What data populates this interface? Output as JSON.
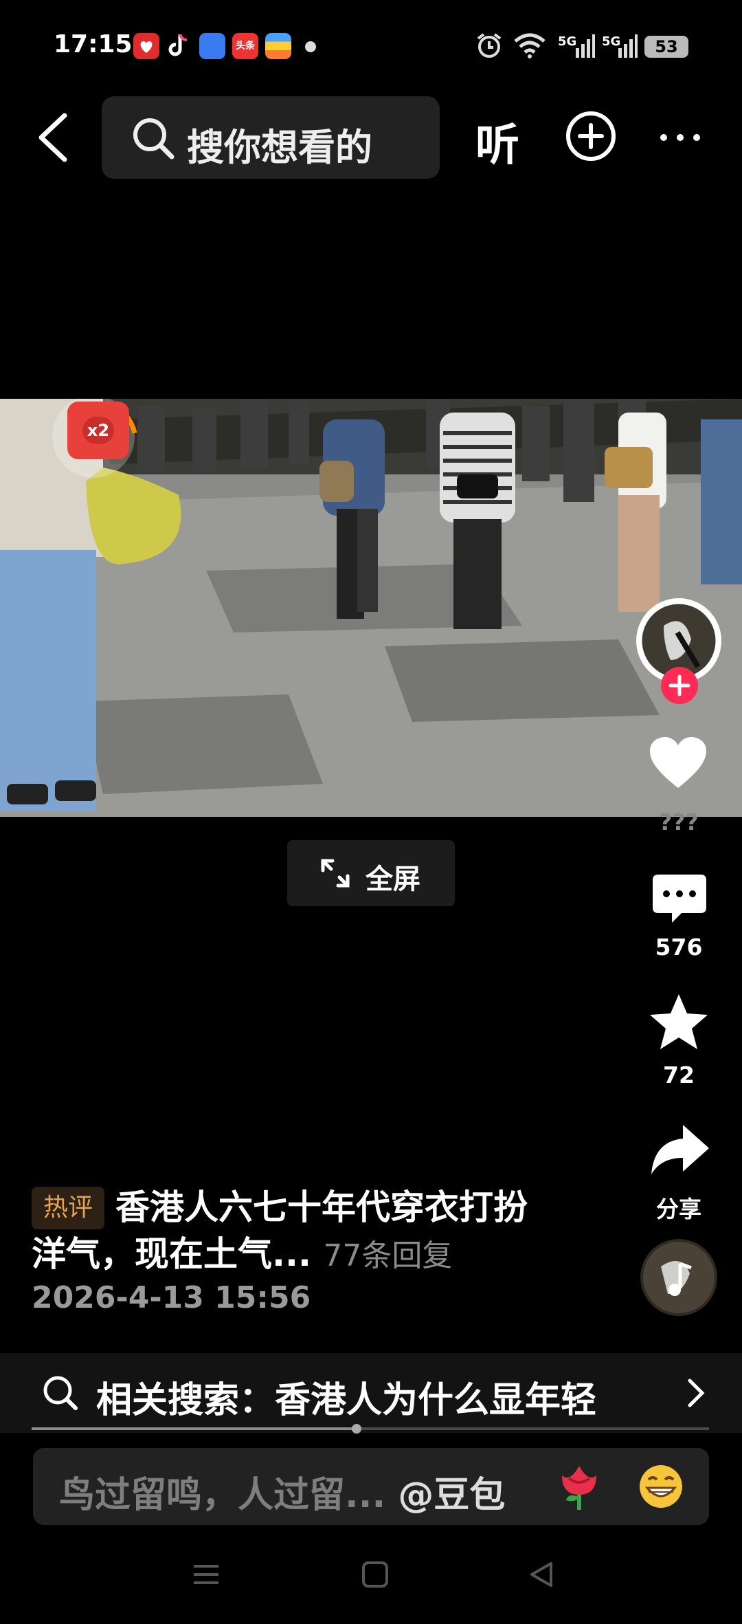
{
  "status_bar": {
    "time": "17:15",
    "network_1": "5G",
    "network_2": "5G",
    "battery": "53",
    "app_icons": [
      "pinduoduo-icon",
      "tiktok-icon",
      "blue-app-icon",
      "toutiao-icon",
      "wallet-app-icon"
    ]
  },
  "top_bar": {
    "search_placeholder": "搜你想看的",
    "listen_label": "听"
  },
  "video": {
    "reward_badge": "x2",
    "fullscreen_label": "全屏"
  },
  "actions": {
    "like_count": "???",
    "comment_count": "576",
    "favorite_count": "72",
    "share_label": "分享"
  },
  "caption": {
    "badge": "热评",
    "line1": "香港人六七十年代穿衣打扮",
    "line2": "洋气，现在土气...",
    "replies": "77条回复",
    "date": "2026-4-13 15:56"
  },
  "related_search": {
    "text": "相关搜索：香港人为什么显年轻",
    "progress": 0.48
  },
  "comment_input": {
    "placeholder": "鸟过留鸣，人过留...",
    "mention": "@豆包"
  },
  "colors": {
    "accent_red": "#fe2c55",
    "badge_orange": "#e8a250"
  }
}
